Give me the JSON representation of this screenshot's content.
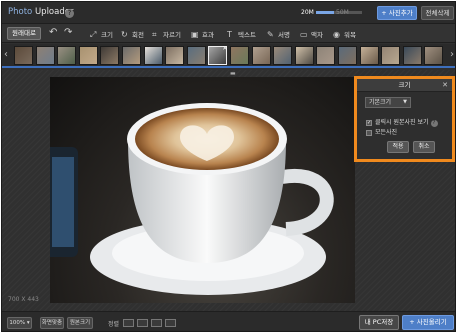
{
  "app": {
    "title_brand": "Photo",
    "title_rest": " Uploader",
    "help_glyph": "?"
  },
  "capacity": {
    "used": "20M",
    "total": "50M",
    "fill_fraction": 0.4
  },
  "header_buttons": {
    "add_photo": "+ 사진추가",
    "delete_all": "전체삭제"
  },
  "toolbar": {
    "original": "원래대로",
    "tools": [
      {
        "icon": "resize-icon",
        "glyph": "⤢",
        "label": "크기"
      },
      {
        "icon": "rotate-icon",
        "glyph": "↻",
        "label": "회전"
      },
      {
        "icon": "crop-icon",
        "glyph": "⌗",
        "label": "자르기"
      },
      {
        "icon": "effect-icon",
        "glyph": "▣",
        "label": "효과"
      },
      {
        "icon": "text-icon",
        "glyph": "T",
        "label": "텍스트"
      },
      {
        "icon": "signature-icon",
        "glyph": "✎",
        "label": "서명"
      },
      {
        "icon": "frame-icon",
        "glyph": "▭",
        "label": "액자"
      },
      {
        "icon": "watermark-icon",
        "glyph": "◉",
        "label": "워목"
      }
    ]
  },
  "filmstrip": {
    "thumb_colors": [
      "#5b4a3a",
      "#7a6a5c",
      "#8d8074",
      "#6f7d8c",
      "#9a9083",
      "#4f5f4a",
      "#a89270",
      "#c2a98a",
      "#3f3a36",
      "#8c7a66",
      "#6b6b6b",
      "#b49b7d",
      "#e6e1da",
      "#4a5a6a",
      "#7d6f62",
      "#c8b8a2",
      "#596d7f",
      "#8a7e70",
      "#a5a5a5",
      "#3c3c3c",
      "#8f7560",
      "#6a7a5a",
      "#b0a090",
      "#786655",
      "#9a8a7a",
      "#526272",
      "#d0c0a8",
      "#4e4a44",
      "#8e8478",
      "#a8988a",
      "#5a6a7a",
      "#7f6f5f",
      "#c4b098",
      "#6a5a4a",
      "#948474",
      "#b8a890",
      "#3a4a5a",
      "#8a7a6a",
      "#a09080",
      "#5c5246"
    ],
    "selected_index": 9,
    "close_glyph": "✕"
  },
  "canvas": {
    "dimensions_label": "700 X 443",
    "drag_glyph": "▬"
  },
  "size_panel": {
    "title": "크기",
    "close_glyph": "✕",
    "preset": "기본크기",
    "option_click_original": "클릭시 원본사진 보기",
    "option_original_photo": "모든사진",
    "apply": "적용",
    "cancel": "취소"
  },
  "bottombar": {
    "zoom": "100%",
    "zoom_caret": "▾",
    "fit": "화면맞춤",
    "original_size": "원본크기",
    "sort_label": "정렬",
    "save_pc": "내 PC저장",
    "upload": "+ 사진올리기"
  }
}
